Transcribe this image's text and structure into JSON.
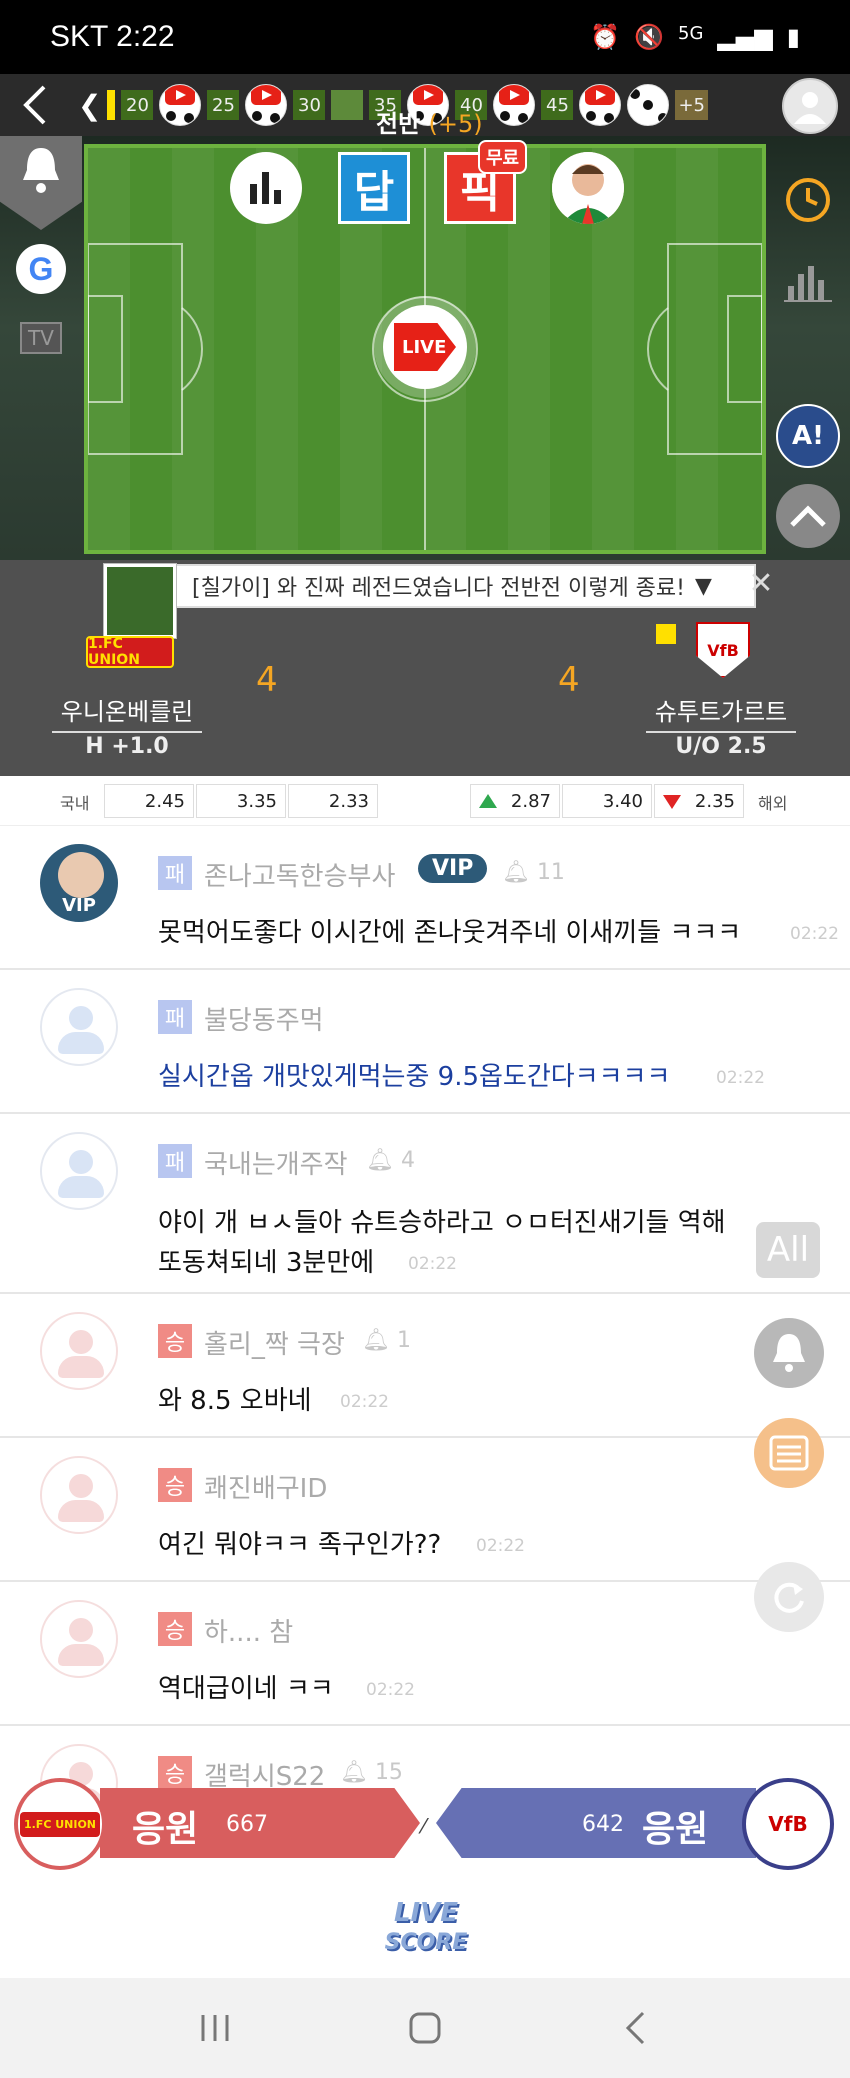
{
  "status_bar": {
    "carrier": "SKT",
    "time": "2:22",
    "network": "5G"
  },
  "timeline": {
    "minutes": [
      "20",
      "25",
      "30",
      "35",
      "40",
      "45"
    ],
    "more": "+5"
  },
  "stream": {
    "live_label": "LIVE",
    "tv_label": "TV",
    "ai_label": "A!",
    "google_label": "G"
  },
  "headline": {
    "text": "[칠가이] 와 진짜 레전드였습니다 전반전 이렇게 종료!"
  },
  "match": {
    "home": {
      "name": "우니온베를린",
      "handicap": "H +1.0",
      "score": "4",
      "logo_text": "1.FC UNION"
    },
    "away": {
      "name": "슈투트가르트",
      "handicap": "U/O 2.5",
      "score": "4",
      "logo_text": "VfB"
    },
    "period": "전반",
    "added_time": "(+5)",
    "buttons": {
      "answer": "답",
      "pick": "픽",
      "free_tag": "무료"
    }
  },
  "odds": {
    "domestic_label": "국내",
    "domestic": [
      "2.45",
      "3.35",
      "2.33"
    ],
    "overseas": [
      "2.87",
      "3.40",
      "2.35"
    ],
    "overseas_label": "해외"
  },
  "chat": [
    {
      "badge": "패",
      "nickname": "존나고독한승부사",
      "vip": "VIP",
      "likes": "11",
      "text": "못먹어도좋다 이시간에 존나웃겨주네 이새끼들 ㅋㅋㅋ",
      "time": "02:22"
    },
    {
      "badge": "패",
      "nickname": "불당동주먹",
      "text": "실시간옵 개맛있게먹는중 9.5옵도간다ㅋㅋㅋㅋ",
      "time": "02:22"
    },
    {
      "badge": "패",
      "nickname": "국내는개주작",
      "likes": "4",
      "text": "야이 개 ㅂㅅ들아 슈트승하라고 ㅇㅁ터진새기들 역해",
      "text2": "또동쳐되네 3분만에",
      "time": "02:22"
    },
    {
      "badge": "승",
      "nickname": "홀리_짝 극장",
      "likes": "1",
      "text": "와 8.5 오바네",
      "time": "02:22"
    },
    {
      "badge": "승",
      "nickname": "쾌진배구ID",
      "text": "여긴 뭐야ㅋㅋ 족구인가??",
      "time": "02:22"
    },
    {
      "badge": "승",
      "nickname": "하.... 참",
      "text": "역대급이네 ㅋㅋ",
      "time": "02:22"
    },
    {
      "badge": "승",
      "nickname": "갤럭시S22",
      "likes": "15"
    }
  ],
  "floating": {
    "all_label": "All"
  },
  "support": {
    "home_label": "응원",
    "home_count": "667",
    "away_label": "응원",
    "away_count": "642"
  },
  "footer": {
    "logo_line1": "LIVE",
    "logo_line2": "SCORE"
  },
  "colors": {
    "pitch": "#4c8f2f",
    "loss_badge": "#b8c6f0",
    "win_badge": "#f08b85",
    "home_support": "#d85e5e",
    "away_support": "#6670b4",
    "score": "#f5a623"
  }
}
